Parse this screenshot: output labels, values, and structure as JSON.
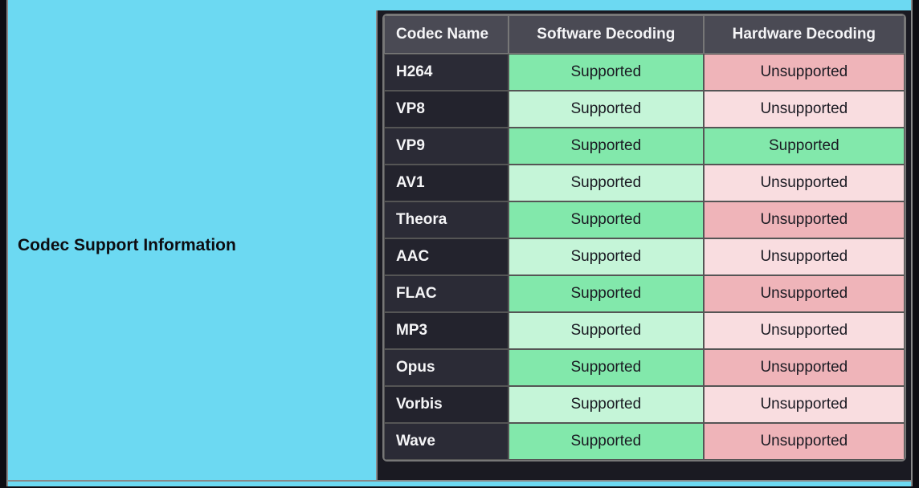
{
  "panel": {
    "title": "Codec Support Information"
  },
  "table": {
    "headers": {
      "name": "Codec Name",
      "software": "Software Decoding",
      "hardware": "Hardware Decoding"
    },
    "rows": [
      {
        "name": "H264",
        "software": "Supported",
        "hardware": "Unsupported"
      },
      {
        "name": "VP8",
        "software": "Supported",
        "hardware": "Unsupported"
      },
      {
        "name": "VP9",
        "software": "Supported",
        "hardware": "Supported"
      },
      {
        "name": "AV1",
        "software": "Supported",
        "hardware": "Unsupported"
      },
      {
        "name": "Theora",
        "software": "Supported",
        "hardware": "Unsupported"
      },
      {
        "name": "AAC",
        "software": "Supported",
        "hardware": "Unsupported"
      },
      {
        "name": "FLAC",
        "software": "Supported",
        "hardware": "Unsupported"
      },
      {
        "name": "MP3",
        "software": "Supported",
        "hardware": "Unsupported"
      },
      {
        "name": "Opus",
        "software": "Supported",
        "hardware": "Unsupported"
      },
      {
        "name": "Vorbis",
        "software": "Supported",
        "hardware": "Unsupported"
      },
      {
        "name": "Wave",
        "software": "Supported",
        "hardware": "Unsupported"
      }
    ]
  }
}
